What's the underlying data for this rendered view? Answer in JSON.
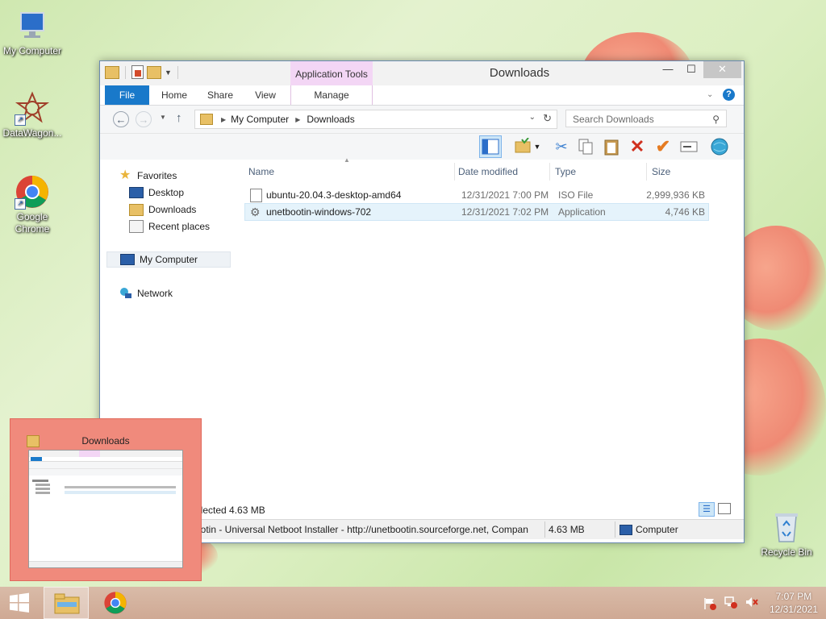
{
  "desktop": {
    "icons": [
      {
        "label": "My Computer",
        "icon": "computer-icon"
      },
      {
        "label": "DataWagon...",
        "icon": "datawagon-icon"
      },
      {
        "label": "Google Chrome",
        "icon": "chrome-icon"
      },
      {
        "label": "Recycle Bin",
        "icon": "recycle-bin-icon"
      }
    ]
  },
  "window": {
    "title": "Downloads",
    "context_tab": "Application Tools",
    "controls": {
      "minimize": "—",
      "maximize": "☐",
      "close": "✕"
    },
    "ribbon_tabs": [
      "File",
      "Home",
      "Share",
      "View",
      "Manage"
    ],
    "address": {
      "segments": [
        "My Computer",
        "Downloads"
      ]
    },
    "search": {
      "placeholder": "Search Downloads"
    },
    "nav": {
      "favorites": "Favorites",
      "favorites_items": [
        "Desktop",
        "Downloads",
        "Recent places"
      ],
      "my_computer": "My Computer",
      "network": "Network"
    },
    "columns": [
      "Name",
      "Date modified",
      "Type",
      "Size"
    ],
    "files": [
      {
        "name": "ubuntu-20.04.3-desktop-amd64",
        "date": "12/31/2021 7:00 PM",
        "type": "ISO File",
        "size": "2,999,936 KB",
        "icon": "disc-image-icon"
      },
      {
        "name": "unetbootin-windows-702",
        "date": "12/31/2021 7:02 PM",
        "type": "Application",
        "size": "4,746 KB",
        "icon": "unetbootin-icon",
        "selected": true
      }
    ],
    "status": {
      "selected": "elected  4.63 MB"
    },
    "details": {
      "description": "ootin - Universal Netboot Installer - http://unetbootin.sourceforge.net, Compan",
      "size": "4.63 MB",
      "location": "Computer"
    }
  },
  "preview": {
    "title": "Downloads"
  },
  "taskbar": {
    "clock_time": "7:07 PM",
    "clock_date": "12/31/2021"
  }
}
